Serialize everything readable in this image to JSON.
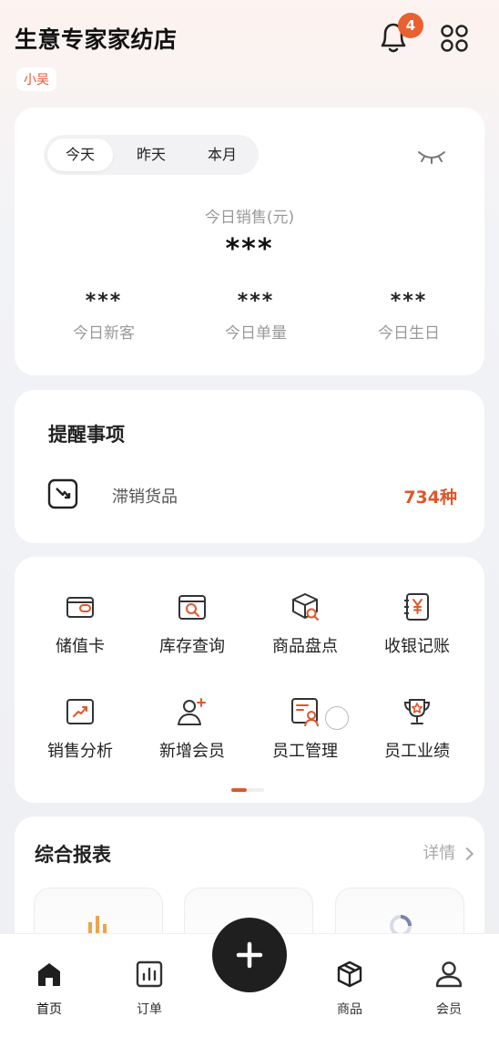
{
  "header": {
    "store_name": "生意专家家纺店",
    "user_tag": "小吴",
    "notification_count": "4"
  },
  "sales": {
    "tabs": [
      {
        "label": "今天",
        "active": true
      },
      {
        "label": "昨天",
        "active": false
      },
      {
        "label": "本月",
        "active": false
      }
    ],
    "main_label": "今日销售(元)",
    "main_value": "***",
    "stats": [
      {
        "value": "***",
        "label": "今日新客"
      },
      {
        "value": "***",
        "label": "今日单量"
      },
      {
        "value": "***",
        "label": "今日生日"
      }
    ]
  },
  "reminders": {
    "title": "提醒事项",
    "items": [
      {
        "label": "滞销货品",
        "count": "734种",
        "icon": "trend-down-icon"
      }
    ]
  },
  "functions": [
    {
      "label": "储值卡",
      "icon": "wallet-card-icon"
    },
    {
      "label": "库存查询",
      "icon": "inventory-search-icon"
    },
    {
      "label": "商品盘点",
      "icon": "box-search-icon"
    },
    {
      "label": "收银记账",
      "icon": "ledger-yen-icon"
    },
    {
      "label": "销售分析",
      "icon": "trend-chart-icon"
    },
    {
      "label": "新增会员",
      "icon": "add-member-icon"
    },
    {
      "label": "员工管理",
      "icon": "staff-manage-icon"
    },
    {
      "label": "员工业绩",
      "icon": "trophy-icon"
    }
  ],
  "report": {
    "title": "综合报表",
    "detail_label": "详情"
  },
  "bottom_nav": [
    {
      "label": "首页",
      "icon": "home-icon",
      "active": true
    },
    {
      "label": "订单",
      "icon": "order-chart-icon",
      "active": false
    },
    {
      "label": "商品",
      "icon": "package-icon",
      "active": false
    },
    {
      "label": "会员",
      "icon": "user-icon",
      "active": false
    }
  ],
  "colors": {
    "accent": "#e0562b",
    "badge": "#e8612f",
    "dark": "#1f1f1f"
  }
}
